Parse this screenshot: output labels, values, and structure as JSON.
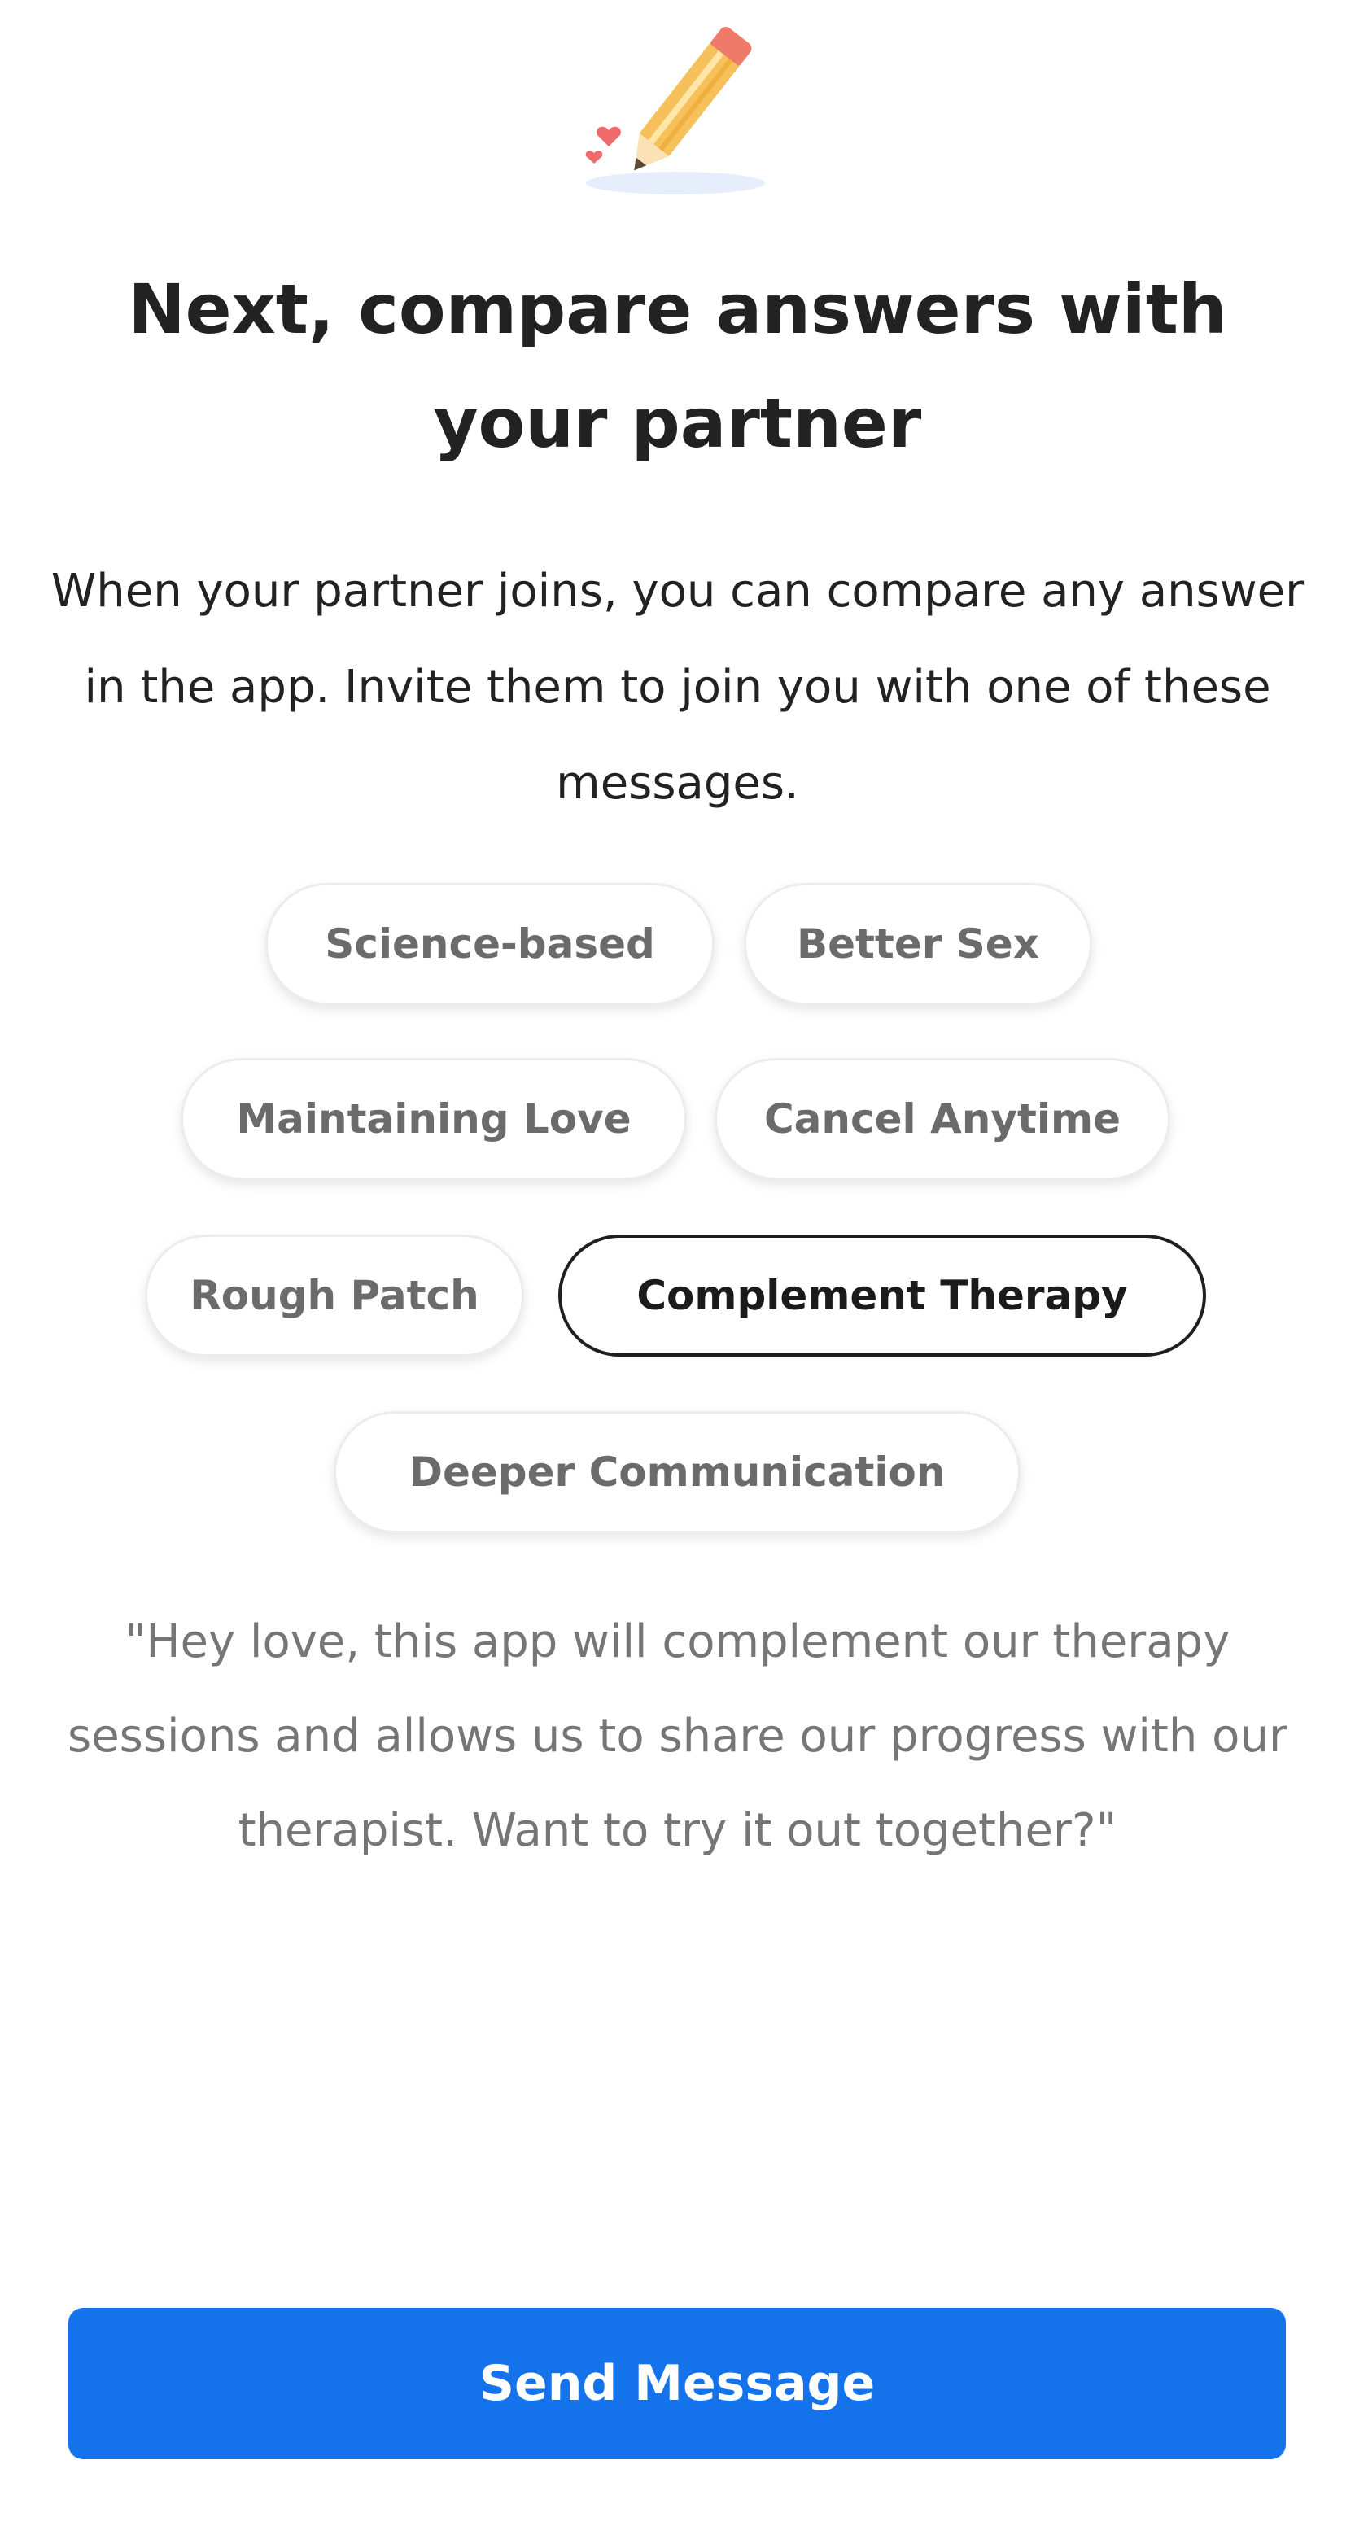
{
  "illustration": {
    "icon": "pencil-with-hearts-icon",
    "colors": {
      "pencil_body": "#f6c15a",
      "pencil_stripe": "#fde6a6",
      "eraser": "#ef7a6a",
      "hearts": "#ef6a6a",
      "shadow": "#e6eefb"
    }
  },
  "title": "Next, compare answers with your partner",
  "subtitle": "When your partner joins, you can compare any answer in the app. Invite them to join you with one of these messages.",
  "chips": [
    {
      "label": "Science-based",
      "selected": false
    },
    {
      "label": "Better Sex",
      "selected": false
    },
    {
      "label": "Maintaining Love",
      "selected": false
    },
    {
      "label": "Cancel Anytime",
      "selected": false
    },
    {
      "label": "Rough Patch",
      "selected": false
    },
    {
      "label": "Complement Therapy",
      "selected": true
    },
    {
      "label": "Deeper Communication",
      "selected": false
    }
  ],
  "message": "\"Hey love, this app will complement our therapy sessions and allows us to share our progress with our therapist. Want to try it out together?\"",
  "send_button": {
    "label": "Send Message",
    "color": "#1473ea"
  }
}
